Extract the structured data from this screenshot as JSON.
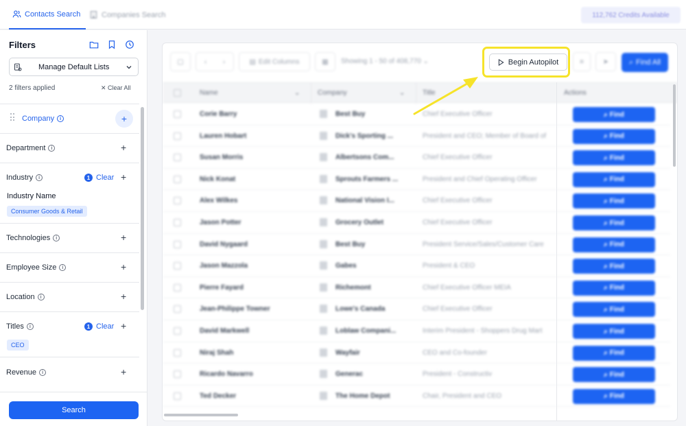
{
  "tabs": {
    "contacts": "Contacts Search",
    "companies": "Companies Search"
  },
  "credits": "112,762 Credits Available",
  "sidebar": {
    "title": "Filters",
    "header_icons": [
      "folder-icon",
      "bookmark-icon",
      "history-icon"
    ],
    "manage_lists": "Manage Default Lists",
    "filters_applied": "2 filters applied",
    "clear_all": "Clear All",
    "search_button": "Search",
    "filters": {
      "company": "Company",
      "department": "Department",
      "industry": "Industry",
      "industry_count": "1",
      "industry_clear": "Clear",
      "industry_name_label": "Industry Name",
      "industry_chip": "Consumer Goods & Retail",
      "technologies": "Technologies",
      "employee_size": "Employee Size",
      "location": "Location",
      "titles": "Titles",
      "titles_count": "1",
      "titles_clear": "Clear",
      "titles_chip": "CEO",
      "revenue": "Revenue"
    }
  },
  "toolbar": {
    "edit_columns": "Edit Columns",
    "showing": "Showing 1 - 50 of 408,770",
    "begin_autopilot": "Begin Autopilot",
    "find_all": "Find All"
  },
  "table": {
    "headers": {
      "name": "Name",
      "company": "Company",
      "title": "Title",
      "actions": "Actions"
    },
    "find_label": "Find",
    "rows": [
      {
        "name": "Corie Barry",
        "company": "Best Buy",
        "title": "Chief Executive Officer"
      },
      {
        "name": "Lauren Hobart",
        "company": "Dick's Sporting ...",
        "title": "President and CEO; Member of Board of"
      },
      {
        "name": "Susan Morris",
        "company": "Albertsons Com...",
        "title": "Chief Executive Officer"
      },
      {
        "name": "Nick Konat",
        "company": "Sprouts Farmers ...",
        "title": "President and Chief Operating Officer"
      },
      {
        "name": "Alex Wilkes",
        "company": "National Vision I...",
        "title": "Chief Executive Officer"
      },
      {
        "name": "Jason Potter",
        "company": "Grocery Outlet",
        "title": "Chief Executive Officer"
      },
      {
        "name": "David Nygaard",
        "company": "Best Buy",
        "title": "President Service/Sales/Customer Care"
      },
      {
        "name": "Jason Mazzola",
        "company": "Gabes",
        "title": "President & CEO"
      },
      {
        "name": "Pierre Fayard",
        "company": "Richemont",
        "title": "Chief Executive Officer MEIA"
      },
      {
        "name": "Jean-Philippe Towner",
        "company": "Lowe's Canada",
        "title": "Chief Executive Officer"
      },
      {
        "name": "David Markwell",
        "company": "Loblaw Compani...",
        "title": "Interim President - Shoppers Drug Mart"
      },
      {
        "name": "Niraj Shah",
        "company": "Wayfair",
        "title": "CEO and Co-founder"
      },
      {
        "name": "Ricardo Navarro",
        "company": "Generac",
        "title": "President - Constructiv"
      },
      {
        "name": "Ted Decker",
        "company": "The Home Depot",
        "title": "Chair, President and CEO"
      }
    ]
  },
  "colors": {
    "accent": "#1d64f2",
    "highlight": "#f6e32a"
  }
}
